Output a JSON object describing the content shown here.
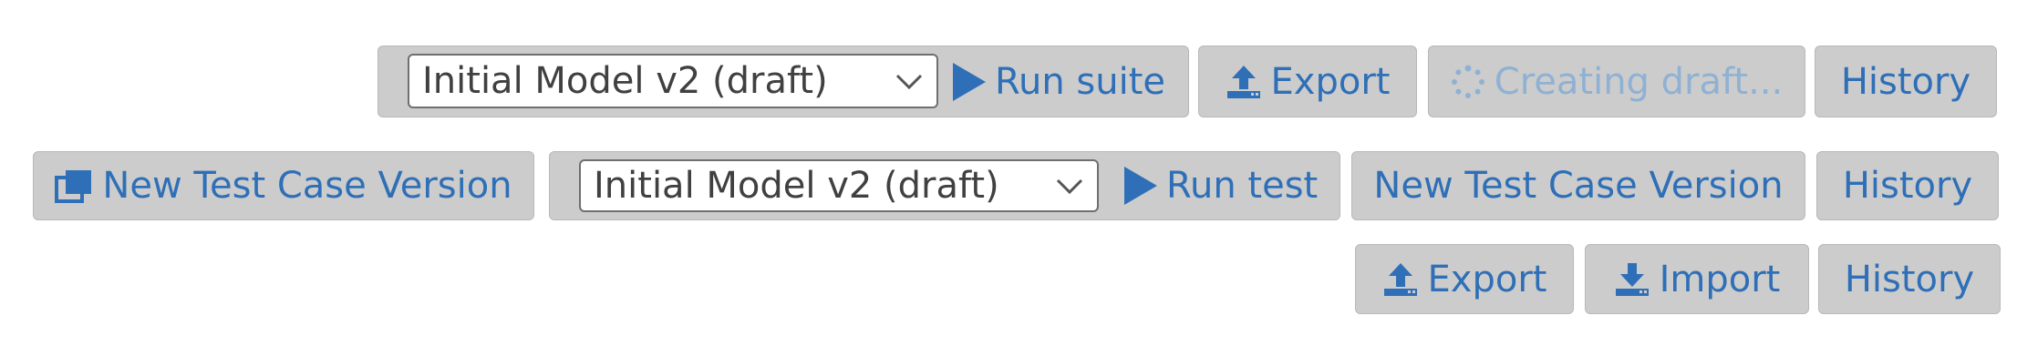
{
  "row1": {
    "model_select": {
      "value": "Initial Model v2 (draft)"
    },
    "run_label": "Run suite",
    "export_label": "Export",
    "creating_label": "Creating draft...",
    "history_label": "History"
  },
  "row2": {
    "new_version_icon_label": "New Test Case Version",
    "model_select": {
      "value": "Initial Model v2 (draft)"
    },
    "run_label": "Run test",
    "new_version_label": "New Test Case Version",
    "history_label": "History"
  },
  "row3": {
    "export_label": "Export",
    "import_label": "Import",
    "history_label": "History"
  },
  "colors": {
    "accent": "#2e6fb7",
    "accent_disabled": "#8fb1d3",
    "button_bg": "#cccccc",
    "border": "#b8b8b8"
  }
}
